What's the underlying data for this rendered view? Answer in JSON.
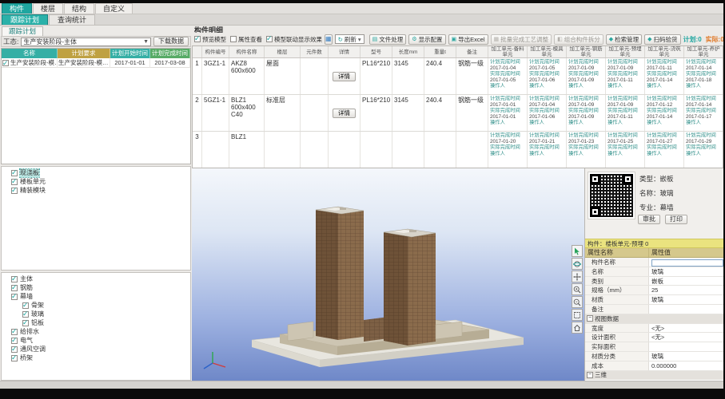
{
  "icons": {
    "grid": "▦",
    "refresh": "↻",
    "caret": "▾",
    "collapse": "−",
    "dropdown": "▼"
  },
  "main_tabs": [
    {
      "label": "构件",
      "active": true
    },
    {
      "label": "楼层",
      "active": false
    },
    {
      "label": "结构",
      "active": false
    },
    {
      "label": "自定义",
      "active": false
    }
  ],
  "sub_tabs": [
    {
      "label": "跟踪计划",
      "active": true
    },
    {
      "label": "查询统计",
      "active": false
    }
  ],
  "plan_panel": {
    "tab_label": "跟踪计划",
    "status_label": "工态:",
    "status_value": "生产安装阶段-主体",
    "download_button": "下载数据",
    "headers": [
      "名称",
      "计划要求",
      "计划开始时间",
      "计划完成时间"
    ],
    "row": {
      "name": "生产安装阶段-模…",
      "require": "生产安装阶段-模…",
      "start": "2017-01-01",
      "finish": "2017-03-08"
    }
  },
  "component_tree": {
    "items": [
      {
        "label": "现浇板",
        "checked": true,
        "selected": true
      },
      {
        "label": "楼板单元",
        "checked": true,
        "selected": false
      },
      {
        "label": "精装模块",
        "checked": true,
        "selected": false
      }
    ]
  },
  "system_tree": {
    "items": [
      {
        "label": "主体",
        "checked": true,
        "level": 0
      },
      {
        "label": "钢筋",
        "checked": true,
        "level": 0
      },
      {
        "label": "幕墙",
        "checked": true,
        "level": 0
      },
      {
        "label": "骨架",
        "checked": true,
        "level": 1
      },
      {
        "label": "玻璃",
        "checked": true,
        "level": 1
      },
      {
        "label": "铝板",
        "checked": true,
        "level": 1
      },
      {
        "label": "给排水",
        "checked": true,
        "level": 0
      },
      {
        "label": "电气",
        "checked": true,
        "level": 0
      },
      {
        "label": "通风空调",
        "checked": true,
        "level": 0
      },
      {
        "label": "桥架",
        "checked": true,
        "level": 0
      }
    ]
  },
  "detail_panel": {
    "title": "构件明细",
    "toolbar": {
      "checkboxes": [
        {
          "label": "预览模型",
          "checked": true
        },
        {
          "label": "属性查看",
          "checked": false
        },
        {
          "label": "模型联动显示效果",
          "checked": true
        }
      ],
      "refresh_label": "刷新",
      "buttons": [
        {
          "label": "文件处理",
          "icon": "▤",
          "disabled": false
        },
        {
          "label": "显示配置",
          "icon": "⚙",
          "disabled": false
        },
        {
          "label": "导出Excel",
          "icon": "▣",
          "disabled": false
        },
        {
          "label": "批量完成工艺调整",
          "icon": "▦",
          "disabled": true
        },
        {
          "label": "组合构件拆分",
          "icon": "◧",
          "disabled": true
        },
        {
          "label": "检索管理",
          "icon": "◆",
          "disabled": false
        },
        {
          "label": "扫码验货",
          "icon": "◆",
          "disabled": false
        }
      ],
      "plan_count": "计划:0",
      "actual_count": "实际:0"
    },
    "table": {
      "headers": [
        "",
        "构件编号",
        "构件名称",
        "楼层",
        "元件数",
        "详情",
        "型号",
        "长度mm",
        "重量t",
        "备注"
      ],
      "unit_headers": [
        "加工单元-备料单元",
        "加工单元-模具单元",
        "加工单元-钢筋单元",
        "加工单元-预埋单元",
        "加工单元-浇筑单元",
        "加工单元-养护单元"
      ],
      "cell_labels": {
        "plan": "计划完成时间",
        "actual": "实际完成时间",
        "operator": "操作人"
      },
      "detail_button": "详情",
      "rows": [
        {
          "num": "1",
          "code": "3GZ1-1",
          "name": "AKZ8 600x600",
          "floor": "屋面",
          "count": "",
          "model": "PL16*210",
          "length": "3145",
          "weight": "240.4",
          "note": "钢筋一级",
          "units": [
            {
              "plan": "2017-01-04",
              "actual": "2017-01-05"
            },
            {
              "plan": "2017-01-05",
              "actual": "2017-01-06"
            },
            {
              "plan": "2017-01-09",
              "actual": "2017-01-09"
            },
            {
              "plan": "2017-01-09",
              "actual": "2017-01-11"
            },
            {
              "plan": "2017-01-11",
              "actual": "2017-01-14"
            },
            {
              "plan": "2017-01-14",
              "actual": "2017-01-18"
            }
          ]
        },
        {
          "num": "2",
          "code": "5GZ1-1",
          "name": "BLZ1 600x400 C40",
          "floor": "标准层",
          "count": "",
          "model": "PL16*210",
          "length": "3145",
          "weight": "240.4",
          "note": "钢筋一级",
          "units": [
            {
              "plan": "2017-01-01",
              "actual": "2017-01-01"
            },
            {
              "plan": "2017-01-04",
              "actual": "2017-01-06"
            },
            {
              "plan": "2017-01-09",
              "actual": "2017-01-09"
            },
            {
              "plan": "2017-01-09",
              "actual": "2017-01-11"
            },
            {
              "plan": "2017-01-12",
              "actual": "2017-01-14"
            },
            {
              "plan": "2017-01-14",
              "actual": "2017-01-17"
            }
          ]
        },
        {
          "num": "3",
          "code": "",
          "name": "BLZ1",
          "floor": "",
          "count": "",
          "model": "",
          "length": "",
          "weight": "",
          "note": "",
          "units": [
            {
              "plan": "2017-01-20",
              "actual": ""
            },
            {
              "plan": "2017-01-21",
              "actual": ""
            },
            {
              "plan": "2017-01-23",
              "actual": ""
            },
            {
              "plan": "2017-01-25",
              "actual": ""
            },
            {
              "plan": "2017-01-27",
              "actual": ""
            },
            {
              "plan": "2017-01-29",
              "actual": ""
            }
          ]
        }
      ]
    }
  },
  "viewport": {
    "tools": [
      "选择",
      "旋转",
      "平移",
      "放大",
      "缩小",
      "范围缩放",
      "主视图"
    ]
  },
  "right_panel": {
    "info": [
      {
        "label": "类型：",
        "value": "嵌板"
      },
      {
        "label": "名称：",
        "value": "玻璃"
      },
      {
        "label": "专业：",
        "value": "幕墙"
      }
    ],
    "buttons": [
      "审批",
      "打印"
    ],
    "selection_label": "构件：楼板单元-预埋 0",
    "prop_headers": [
      "属性名称",
      "属性值"
    ],
    "props": [
      {
        "label": "构件名称",
        "value": ""
      },
      {
        "label": "名称",
        "value": "玻璃"
      },
      {
        "label": "类别",
        "value": "嵌板"
      },
      {
        "label": "规格（mm）",
        "value": "25"
      },
      {
        "label": "材质",
        "value": "玻璃"
      },
      {
        "label": "备注",
        "value": ""
      },
      {
        "label": "视图数据",
        "value": ""
      },
      {
        "label": "宽度",
        "value": "<无>"
      },
      {
        "label": "设计面积",
        "value": "<无>"
      },
      {
        "label": "实际面积",
        "value": ""
      },
      {
        "label": "材质分类",
        "value": "玻璃"
      },
      {
        "label": "成本",
        "value": "0.000000"
      },
      {
        "label": "三维",
        "value": ""
      }
    ]
  }
}
